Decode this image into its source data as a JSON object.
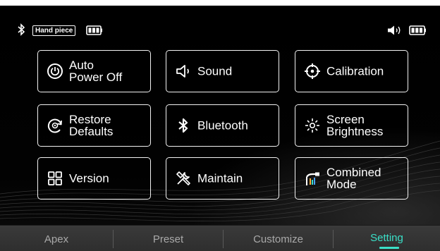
{
  "status": {
    "handpiece_label": "Hand piece",
    "handpiece_battery_icon": "battery-full-icon",
    "bluetooth_icon": "bluetooth-icon",
    "volume_icon": "speaker-volume-icon",
    "device_battery_icon": "battery-full-icon"
  },
  "settings": {
    "tiles": [
      {
        "label": "Auto\nPower Off",
        "icon": "power-icon"
      },
      {
        "label": "Sound",
        "icon": "speaker-icon"
      },
      {
        "label": "Calibration",
        "icon": "crosshair-icon"
      },
      {
        "label": "Restore\nDefaults",
        "icon": "restore-icon"
      },
      {
        "label": "Bluetooth",
        "icon": "bluetooth-icon"
      },
      {
        "label": "Screen\nBrightness",
        "icon": "brightness-icon"
      },
      {
        "label": "Version",
        "icon": "grid-icon"
      },
      {
        "label": "Maintain",
        "icon": "tools-icon"
      },
      {
        "label": "Combined\nMode",
        "icon": "combined-mode-icon"
      }
    ]
  },
  "tabs": [
    {
      "label": "Apex"
    },
    {
      "label": "Preset"
    },
    {
      "label": "Customize"
    },
    {
      "label": "Setting"
    }
  ],
  "active_tab": "Setting",
  "colors": {
    "accent": "#3ae0c8",
    "background": "#000000",
    "tabbar": "#333333",
    "tab_inactive_text": "#a9a9a9"
  }
}
